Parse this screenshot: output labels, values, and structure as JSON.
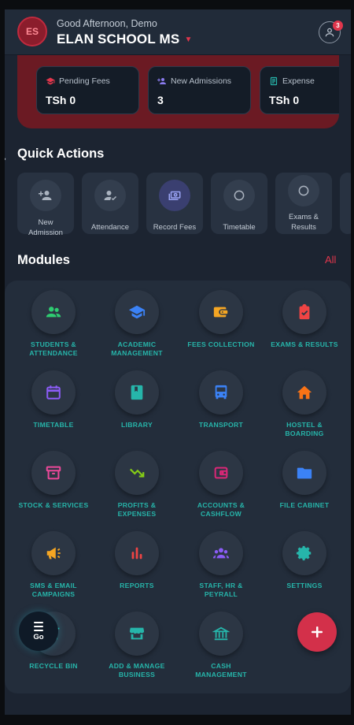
{
  "header": {
    "logo_initials": "ES",
    "greeting": "Good Afternoon, Demo",
    "school_name": "ELAN SCHOOL MS",
    "notification_count": "3"
  },
  "stats": [
    {
      "label": "Pending Fees",
      "value": "TSh 0",
      "icon": "graduation-cap-icon",
      "color": "#e0364c"
    },
    {
      "label": "New Admissions",
      "value": "3",
      "icon": "person-add-icon",
      "color": "#8b7cf0"
    },
    {
      "label": "Expense",
      "value": "TSh 0",
      "icon": "receipt-icon",
      "color": "#26b5aa"
    }
  ],
  "quick_actions": {
    "title": "Quick Actions",
    "items": [
      {
        "label_line1": "New",
        "label_line2": "Admission",
        "icon": "person-add-icon"
      },
      {
        "label_line1": "Attendance",
        "label_line2": "",
        "icon": "person-check-icon"
      },
      {
        "label_line1": "Record Fees",
        "label_line2": "",
        "icon": "cash-icon"
      },
      {
        "label_line1": "Timetable",
        "label_line2": "",
        "icon": "circle-icon"
      },
      {
        "label_line1": "Exams &",
        "label_line2": "Results",
        "icon": "circle-icon"
      }
    ]
  },
  "modules": {
    "title": "Modules",
    "all_link": "All",
    "items": [
      {
        "line1": "STUDENTS &",
        "line2": "ATTENDANCE",
        "icon": "students-icon",
        "color": "#2ecc71"
      },
      {
        "line1": "ACADEMIC",
        "line2": "MANAGEMENT",
        "icon": "graduation-cap-icon",
        "color": "#3b82f6"
      },
      {
        "line1": "FEES COLLECTION",
        "line2": "",
        "icon": "wallet-icon",
        "color": "#f5a623"
      },
      {
        "line1": "EXAMS & RESULTS",
        "line2": "",
        "icon": "clipboard-check-icon",
        "color": "#ef4444"
      },
      {
        "line1": "TIMETABLE",
        "line2": "",
        "icon": "calendar-icon",
        "color": "#8b5cf6"
      },
      {
        "line1": "LIBRARY",
        "line2": "",
        "icon": "book-icon",
        "color": "#26b5aa"
      },
      {
        "line1": "TRANSPORT",
        "line2": "",
        "icon": "bus-icon",
        "color": "#3b82f6"
      },
      {
        "line1": "HOSTEL &",
        "line2": "BOARDING",
        "icon": "house-icon",
        "color": "#f97316"
      },
      {
        "line1": "STOCK & SERVICES",
        "line2": "",
        "icon": "archive-icon",
        "color": "#ec4899"
      },
      {
        "line1": "PROFITS &",
        "line2": "EXPENSES",
        "icon": "trending-down-icon",
        "color": "#84cc16"
      },
      {
        "line1": "ACCOUNTS &",
        "line2": "CASHFLOW",
        "icon": "wallet-icon",
        "color": "#db2777"
      },
      {
        "line1": "FILE CABINET",
        "line2": "",
        "icon": "folder-icon",
        "color": "#3b82f6"
      },
      {
        "line1": "SMS & EMAIL",
        "line2": "CAMPAIGNS",
        "icon": "megaphone-icon",
        "color": "#f5a623"
      },
      {
        "line1": "REPORTS",
        "line2": "",
        "icon": "bar-chart-icon",
        "color": "#ef4444"
      },
      {
        "line1": "STAFF, HR &",
        "line2": "PEYRALL",
        "icon": "group-icon",
        "color": "#8b5cf6"
      },
      {
        "line1": "SETTINGS",
        "line2": "",
        "icon": "gear-icon",
        "color": "#26b5aa"
      },
      {
        "line1": "RECYCLE BIN",
        "line2": "",
        "icon": "trash-icon",
        "color": "#26b5aa"
      },
      {
        "line1": "ADD & MANAGE",
        "line2": "BUSINESS",
        "icon": "store-icon",
        "color": "#26b5aa"
      },
      {
        "line1": "CASH",
        "line2": "MANAGEMENT",
        "icon": "bank-icon",
        "color": "#26b5aa"
      }
    ]
  },
  "go_button": {
    "label": "Go",
    "icon": "menu-icon"
  },
  "fab": {
    "icon": "plus-icon"
  }
}
